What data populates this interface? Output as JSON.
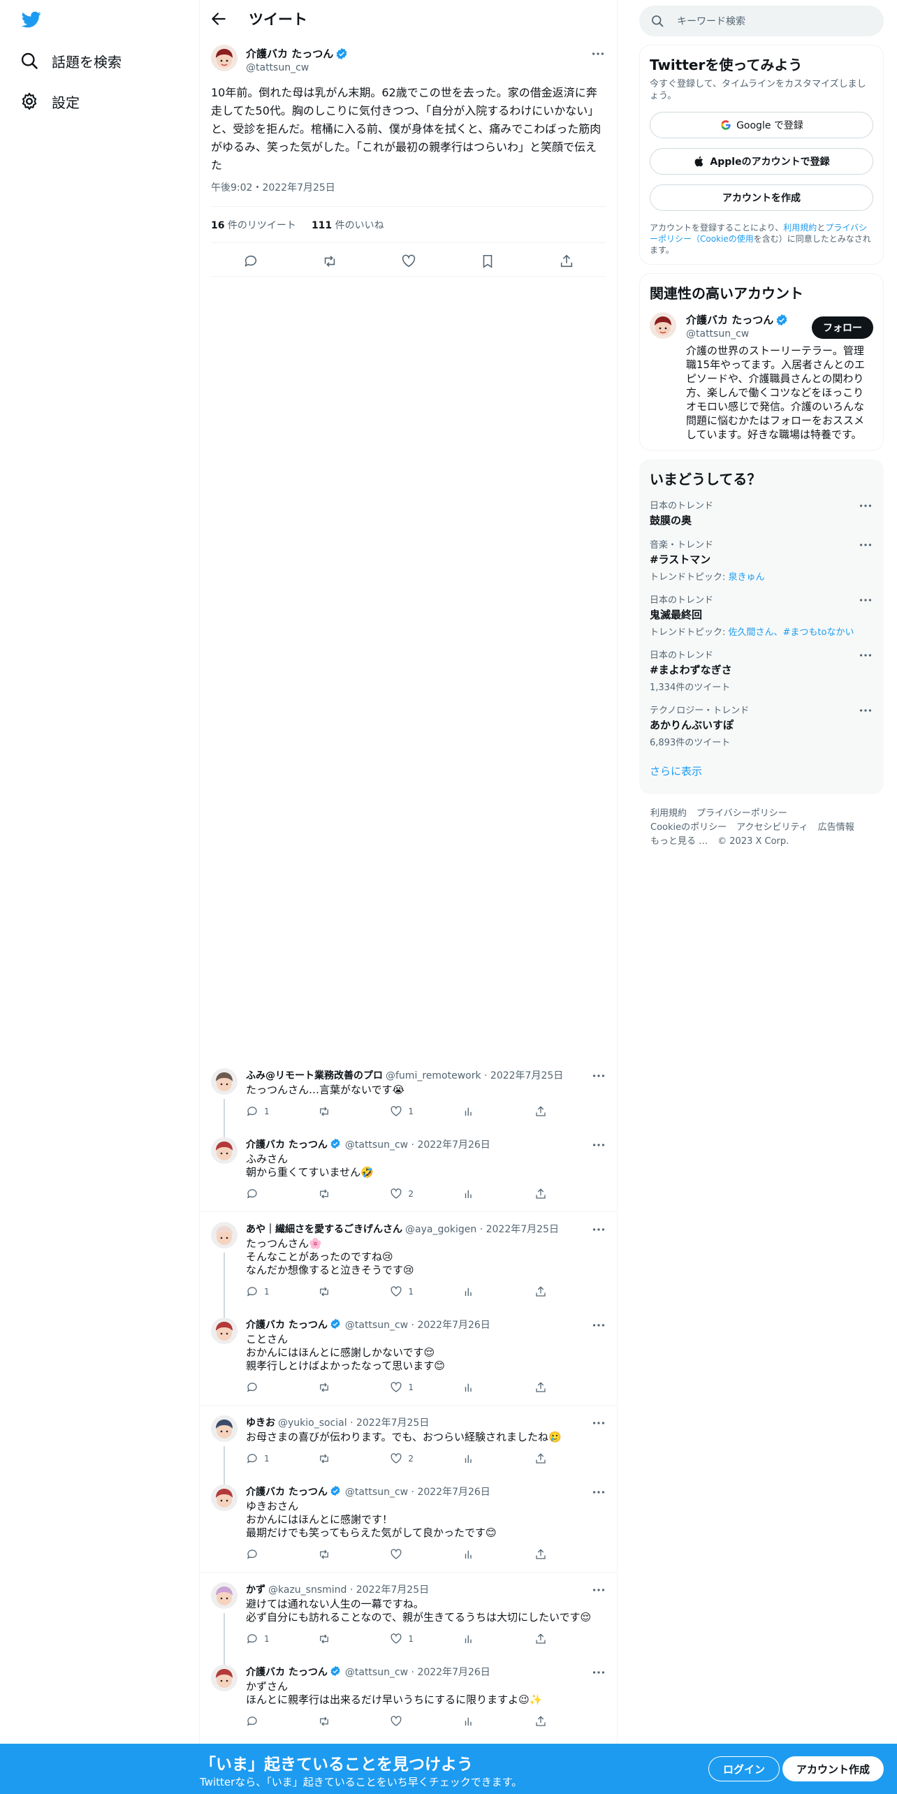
{
  "colors": {
    "accent": "#1d9bf0",
    "text": "#0f1419",
    "muted": "#536471",
    "border": "#eff3f4"
  },
  "nav": [
    {
      "label": "話題を検索",
      "icon": "search-icon"
    },
    {
      "label": "設定",
      "icon": "gear-icon"
    }
  ],
  "header": {
    "title": "ツイート"
  },
  "tweet": {
    "name": "介護バカ たっつん",
    "handle": "@tattsun_cw",
    "text": "10年前。倒れた母は乳がん末期。62歳でこの世を去った。家の借金返済に奔走してた50代。胸のしこりに気付きつつ、「自分が入院するわけにいかない」と、受診を拒んだ。棺桶に入る前、僕が身体を拭くと、痛みでこわばった筋肉がゆるみ、笑った気がした。「これが最初の親孝行はつらいわ」と笑顔で伝えた",
    "time": "午後9:02・2022年7月25日",
    "retweets": "16",
    "retweets_label": " 件のリツイート",
    "likes": "111",
    "likes_label": " 件のいいね"
  },
  "replies": [
    {
      "name": "ふみ@リモート業務改善のプロ",
      "meta": "@fumi_remotework · 2022年7月25日",
      "text": "たっつんさん…言葉がないです😭",
      "reply": "1",
      "like": "1",
      "avatar": "#6b5a4e",
      "line": true,
      "sep": false
    },
    {
      "name": "介護バカ たっつん",
      "meta": "@tattsun_cw · 2022年7月26日",
      "text": "ふみさん\n朝から重くてすいません🤣",
      "reply": "",
      "like": "2",
      "avatar": "#b33a3a",
      "verified": true,
      "line": false,
      "sep": true
    },
    {
      "name": "あや｜繊細さを愛するごきげんさん",
      "meta": "@aya_gokigen · 2022年7月25日",
      "text": "たっつんさん🌸\nそんなことがあったのですね😢\nなんだか想像すると泣きそうです😢",
      "reply": "1",
      "like": "1",
      "avatar": "#f0d9d2",
      "line": true,
      "sep": false
    },
    {
      "name": "介護バカ たっつん",
      "meta": "@tattsun_cw · 2022年7月26日",
      "text": "ことさん\nおかんにはほんとに感謝しかないです😌\n親孝行しとけばよかったなって思います😊",
      "reply": "",
      "like": "1",
      "avatar": "#b33a3a",
      "verified": true,
      "line": false,
      "sep": true
    },
    {
      "name": "ゆきお",
      "meta": "@yukio_social · 2022年7月25日",
      "text": "お母さまの喜びが伝わります。でも、おつらい経験されましたね🥲",
      "reply": "1",
      "like": "2",
      "avatar": "#3a4a6b",
      "line": true,
      "sep": false
    },
    {
      "name": "介護バカ たっつん",
      "meta": "@tattsun_cw · 2022年7月26日",
      "text": "ゆきおさん\nおかんにはほんとに感謝です！\n最期だけでも笑ってもらえた気がして良かったです😊",
      "reply": "",
      "like": "",
      "avatar": "#b33a3a",
      "verified": true,
      "line": false,
      "sep": true
    },
    {
      "name": "かず",
      "meta": "@kazu_snsmind · 2022年7月25日",
      "text": "避けては通れない人生の一幕ですね。\n必ず自分にも訪れることなので、親が生きてるうちは大切にしたいです😌",
      "reply": "1",
      "like": "1",
      "avatar": "#c9a3d6",
      "line": true,
      "sep": false
    },
    {
      "name": "介護バカ たっつん",
      "meta": "@tattsun_cw · 2022年7月26日",
      "text": "かずさん\nほんとに親孝行は出来るだけ早いうちにするに限りますよ😉✨",
      "reply": "",
      "like": "",
      "avatar": "#b33a3a",
      "verified": true,
      "line": false,
      "sep": false
    }
  ],
  "search": {
    "placeholder": "キーワード検索"
  },
  "signup_card": {
    "title": "Twitterを使ってみよう",
    "subtitle": "今すぐ登録して、タイムラインをカスタマイズしましょう。",
    "google": "Google で登録",
    "apple": "Appleのアカウントで登録",
    "create": "アカウントを作成",
    "legal_1": "アカウントを登録することにより、",
    "legal_link1": "利用規約",
    "legal_2": "と",
    "legal_link2": "プライバシーポリシー（Cookieの使用",
    "legal_3": "を含む）に同意したとみなされます。"
  },
  "related": {
    "title": "関連性の高いアカウント",
    "name": "介護バカ たっつん",
    "handle": "@tattsun_cw",
    "follow": "フォロー",
    "bio": "介護の世界のストーリーテラー。管理職15年やってます。入居者さんとのエピソードや、介護職員さんとの関わり方、楽しんで働くコツなどをほっこりオモロい感じで発信。介護のいろんな問題に悩むかたはフォローをおススメしています。好きな職場は特養です。"
  },
  "trends": {
    "title": "いまどうしてる？",
    "items": [
      {
        "cat": "日本のトレンド",
        "name": "鼓膜の奥",
        "meta_prefix": "",
        "meta_link": ""
      },
      {
        "cat": "音楽・トレンド",
        "name": "#ラストマン",
        "meta_prefix": "トレンドトピック: ",
        "meta_link": "泉きゅん"
      },
      {
        "cat": "日本のトレンド",
        "name": "鬼滅最終回",
        "meta_prefix": "トレンドトピック: ",
        "meta_link": "佐久間さん、#まつもtoなかい"
      },
      {
        "cat": "日本のトレンド",
        "name": "#まよわずなぎさ",
        "meta_prefix": "1,334件のツイート",
        "meta_link": ""
      },
      {
        "cat": "テクノロジー・トレンド",
        "name": "あかりんぶいすぽ",
        "meta_prefix": "6,893件のツイート",
        "meta_link": ""
      }
    ],
    "show_more": "さらに表示"
  },
  "footer": {
    "row1": [
      "利用規約",
      "プライバシーポリシー"
    ],
    "row2": [
      "Cookieのポリシー",
      "アクセシビリティ",
      "広告情報"
    ],
    "row3": [
      "もっと見る …",
      "© 2023 X Corp."
    ]
  },
  "bottombar": {
    "title": "「いま」起きていることを見つけよう",
    "subtitle": "Twitterなら、「いま」起きていることをいち早くチェックできます。",
    "login": "ログイン",
    "signup": "アカウント作成"
  }
}
